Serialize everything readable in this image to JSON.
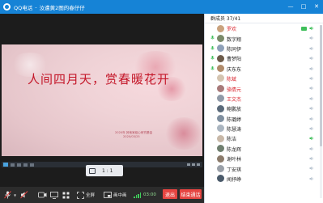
{
  "window": {
    "app_name": "QQ电话",
    "separator": "-",
    "title": "汝遭黄2图的春仔仔",
    "controls": [
      "minimize",
      "maximize",
      "close"
    ]
  },
  "slide": {
    "title": "人间四月天，赏春暖花开",
    "subtitle_line1": "2020年 其他家组心研究基金",
    "subtitle_line2": "2020/03/25"
  },
  "video_controls": {
    "ratio_label": "1 : 1"
  },
  "toolbar": {
    "fullscreen_label": "全屏",
    "pip_label": "画中画",
    "timer": "03:00",
    "exit_label": "退出",
    "end_call_label": "结束通话"
  },
  "members": {
    "header": "群成员 37/41",
    "list": [
      {
        "name": "罗欢",
        "red": true,
        "has_mic": false,
        "avatar_color": "#c9a27e",
        "camera": true,
        "speaker": true
      },
      {
        "name": "数字翔",
        "red": false,
        "has_mic": true,
        "avatar_color": "#7a8a6a",
        "camera": false,
        "speaker": true
      },
      {
        "name": "陈同伊",
        "red": false,
        "has_mic": true,
        "avatar_color": "#8ea0b8",
        "camera": false,
        "speaker": true
      },
      {
        "name": "曹梦阳",
        "red": false,
        "has_mic": true,
        "avatar_color": "#6c5b4a",
        "camera": false,
        "speaker": true
      },
      {
        "name": "庆东东",
        "red": false,
        "has_mic": true,
        "avatar_color": "#b08b6a",
        "camera": false,
        "speaker": true
      },
      {
        "name": "陈斌",
        "red": true,
        "has_mic": false,
        "avatar_color": "#d4c4b0",
        "camera": false,
        "speaker": true
      },
      {
        "name": "骆倩元",
        "red": true,
        "has_mic": false,
        "avatar_color": "#a87a7a",
        "camera": false,
        "speaker": true
      },
      {
        "name": "王文杰",
        "red": true,
        "has_mic": false,
        "avatar_color": "#909aa8",
        "camera": false,
        "speaker": true
      },
      {
        "name": "鲍鹏放",
        "red": false,
        "has_mic": false,
        "avatar_color": "#5a6a7a",
        "camera": false,
        "speaker": true
      },
      {
        "name": "陈璐婷",
        "red": false,
        "has_mic": false,
        "avatar_color": "#7f8f9f",
        "camera": false,
        "speaker": true
      },
      {
        "name": "陈慧涛",
        "red": false,
        "has_mic": false,
        "avatar_color": "#aab5c0",
        "camera": false,
        "speaker": true
      },
      {
        "name": "陈洁",
        "red": false,
        "has_mic": false,
        "avatar_color": "#c8b8a8",
        "camera": false,
        "speaker": true
      },
      {
        "name": "陈龙辉",
        "red": false,
        "has_mic": false,
        "avatar_color": "#6f7f6f",
        "camera": false,
        "speaker": true
      },
      {
        "name": "谢叶林",
        "red": false,
        "has_mic": false,
        "avatar_color": "#8b7b6b",
        "camera": false,
        "speaker": true
      },
      {
        "name": "丁安琪",
        "red": false,
        "has_mic": false,
        "avatar_color": "#9aa0a8",
        "camera": false,
        "speaker": true
      },
      {
        "name": "闻抒峥",
        "red": false,
        "has_mic": false,
        "avatar_color": "#4a5a6a",
        "camera": false,
        "speaker": true
      }
    ]
  },
  "colors": {
    "title_bar": "#1683d6",
    "red_name": "#d8202a",
    "exit_button": "#e64541",
    "signal": "#3fcf5a"
  }
}
